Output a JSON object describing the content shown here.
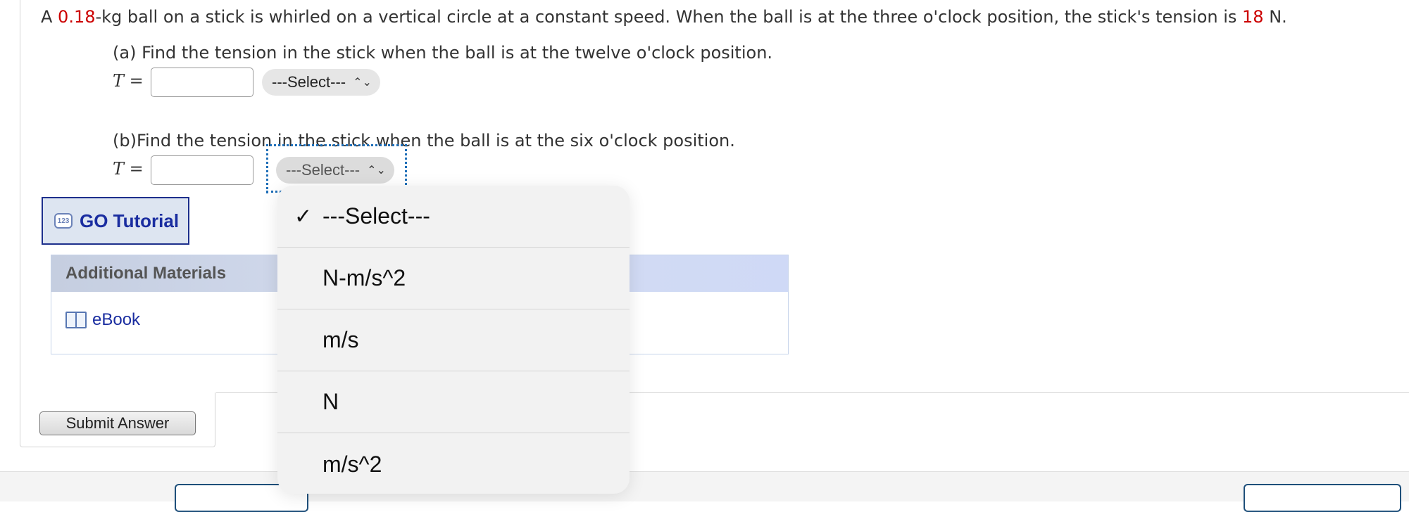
{
  "problem": {
    "text_1": "A ",
    "mass_value": "0.18",
    "text_2": "-kg ball on a stick is whirled on a vertical circle at a constant speed. When the ball is at the three o'clock position, the stick's tension is ",
    "tension_value": "18",
    "text_3": " N."
  },
  "part_a": {
    "prompt": "(a) Find the tension in the stick when the ball is at the twelve o'clock position.",
    "variable": "T",
    "equals": "=",
    "input_value": "",
    "unit_select": "---Select---"
  },
  "part_b": {
    "prompt": "(b)Find the tension in the stick when the ball is at the six o'clock position.",
    "variable": "T",
    "equals": "=",
    "input_value": "",
    "unit_select": "---Select---"
  },
  "go_tutorial": {
    "label": "GO Tutorial",
    "icon_text": "123"
  },
  "additional_materials": {
    "header": "Additional Materials",
    "ebook_label": "eBook"
  },
  "submit_label": "Submit Answer",
  "dropdown": {
    "selected_index": 0,
    "check": "✓",
    "options": [
      "---Select---",
      "N-m/s^2",
      "m/s",
      "N",
      "m/s^2"
    ]
  },
  "colors": {
    "highlight": "#cc0000",
    "link": "#1a2da0",
    "focus": "#1f6fb8"
  }
}
